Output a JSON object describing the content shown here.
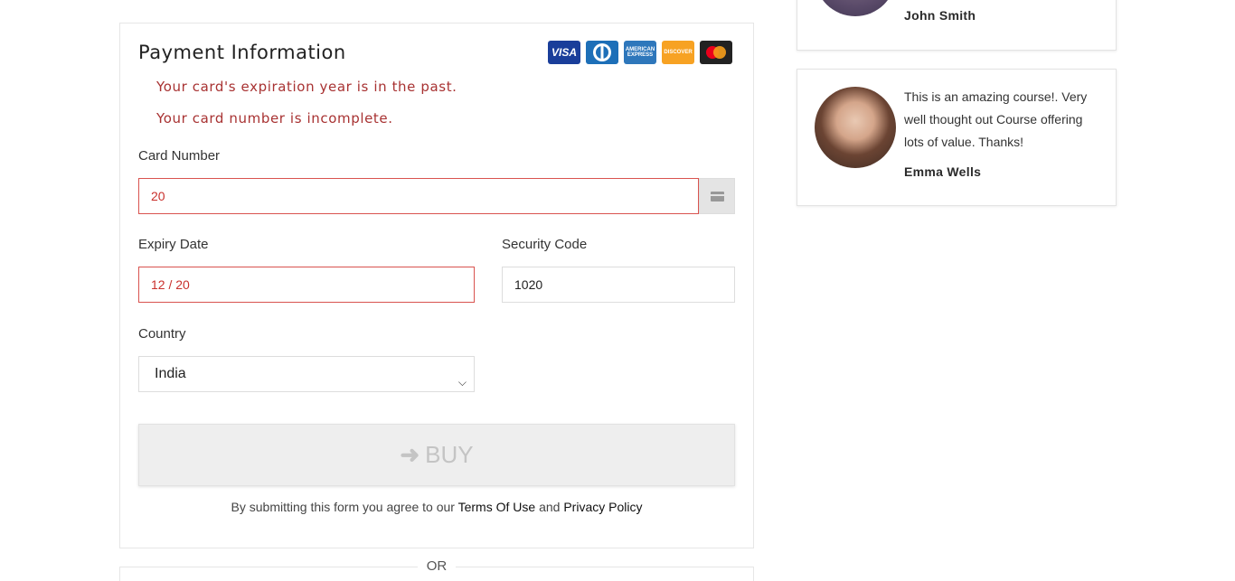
{
  "payment": {
    "title": "Payment Information",
    "card_logos": [
      {
        "name": "visa-logo",
        "label": "VISA"
      },
      {
        "name": "diners-logo",
        "label": ""
      },
      {
        "name": "amex-logo",
        "label": "AMERICAN EXPRESS"
      },
      {
        "name": "discover-logo",
        "label": "DISCOVER"
      },
      {
        "name": "mastercard-logo",
        "label": ""
      }
    ],
    "errors": [
      "Your card's expiration year is in the past.",
      "Your card number is incomplete."
    ],
    "card_number": {
      "label": "Card Number",
      "value": "20"
    },
    "expiry": {
      "label": "Expiry Date",
      "value": "12 / 20"
    },
    "security": {
      "label": "Security Code",
      "value": "1020"
    },
    "country": {
      "label": "Country",
      "value": "India"
    },
    "buy_label": "BUY",
    "agree": {
      "prefix": "By submitting this form you agree to our ",
      "terms": "Terms Of Use",
      "middle": " and ",
      "privacy": "Privacy Policy"
    },
    "or_text": "OR"
  },
  "testimonials": [
    {
      "quote": "",
      "author": "John Smith"
    },
    {
      "quote": "This is an amazing course!. Very well thought out Course offering lots of value. Thanks!",
      "author": "Emma Wells"
    }
  ],
  "colors": {
    "error": "#a83232",
    "invalid_border": "#d9534f",
    "button_bg": "#eeeeee"
  }
}
